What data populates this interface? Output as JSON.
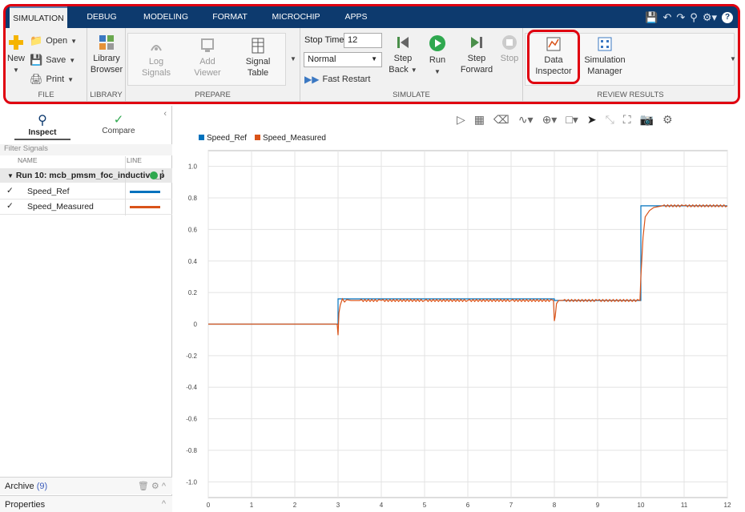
{
  "tabs": [
    {
      "label": "SIMULATION",
      "active": true
    },
    {
      "label": "DEBUG"
    },
    {
      "label": "MODELING"
    },
    {
      "label": "FORMAT"
    },
    {
      "label": "MICROCHIP"
    },
    {
      "label": "APPS"
    }
  ],
  "file": {
    "new": "New",
    "open": "Open",
    "save": "Save",
    "print": "Print",
    "group": "FILE"
  },
  "library": {
    "btn1": "Library",
    "btn2": "Browser",
    "group": "LIBRARY"
  },
  "prepare": {
    "log1": "Log",
    "log2": "Signals",
    "add1": "Add",
    "add2": "Viewer",
    "sig1": "Signal",
    "sig2": "Table",
    "group": "PREPARE"
  },
  "simulate": {
    "stop_time_label": "Stop Time",
    "stop_time_value": "12",
    "mode": "Normal",
    "fast_restart": "Fast Restart",
    "step_back1": "Step",
    "step_back2": "Back",
    "run": "Run",
    "step_fwd1": "Step",
    "step_fwd2": "Forward",
    "stop": "Stop",
    "group": "SIMULATE"
  },
  "review": {
    "di1": "Data",
    "di2": "Inspector",
    "sm1": "Simulation",
    "sm2": "Manager",
    "group": "REVIEW RESULTS"
  },
  "left": {
    "inspect": "Inspect",
    "compare": "Compare",
    "filter": "Filter Signals",
    "col_name": "NAME",
    "col_line": "LINE",
    "run": "Run 10: mcb_pmsm_foc_inductive_p",
    "signals": [
      "Speed_Ref",
      "Speed_Measured"
    ],
    "archive": "Archive",
    "archive_count": "(9)",
    "properties": "Properties"
  },
  "colors": {
    "ref": "#0072bd",
    "meas": "#d95319",
    "accent": "#e00010"
  },
  "chart_data": {
    "type": "line",
    "xlim": [
      0,
      12
    ],
    "ylim": [
      -1.1,
      1.1
    ],
    "xticks": [
      0,
      1,
      2,
      3,
      4,
      5,
      6,
      7,
      8,
      9,
      10,
      11,
      12
    ],
    "yticks": [
      -1.0,
      -0.8,
      -0.6,
      -0.4,
      -0.2,
      0,
      0.2,
      0.4,
      0.6,
      0.8,
      1.0
    ],
    "xtick_labels": [
      "0",
      "1",
      "2",
      "3",
      "4",
      "5",
      "6",
      "7",
      "8",
      "9",
      "10",
      "11",
      "12"
    ],
    "ytick_labels": [
      "-1.0",
      "-0.8",
      "-0.6",
      "-0.4",
      "-0.2",
      "0",
      "0.2",
      "0.4",
      "0.6",
      "0.8",
      "1.0"
    ],
    "grid": true,
    "legend_position": "top-left",
    "series": [
      {
        "name": "Speed_Ref",
        "x": [
          0,
          3,
          3,
          8,
          8,
          8.1,
          10,
          10,
          12
        ],
        "y": [
          0,
          0,
          0.16,
          0.16,
          0.15,
          0.15,
          0.15,
          0.75,
          0.75
        ]
      },
      {
        "name": "Speed_Measured",
        "x": [
          0,
          2.98,
          3.0,
          3.02,
          3.05,
          3.1,
          3.15,
          3.2,
          3.3,
          3.5,
          4,
          5,
          6,
          7,
          7.98,
          8.0,
          8.02,
          8.05,
          8.1,
          8.2,
          9,
          9.98,
          10.0,
          10.05,
          10.1,
          10.2,
          10.3,
          10.5,
          11,
          12
        ],
        "y": [
          0,
          0,
          -0.07,
          0.07,
          0.12,
          0.16,
          0.14,
          0.155,
          0.15,
          0.15,
          0.15,
          0.15,
          0.15,
          0.15,
          0.15,
          0.02,
          0.05,
          0.13,
          0.15,
          0.15,
          0.15,
          0.15,
          0.3,
          0.55,
          0.68,
          0.72,
          0.74,
          0.75,
          0.75,
          0.75
        ]
      }
    ]
  }
}
